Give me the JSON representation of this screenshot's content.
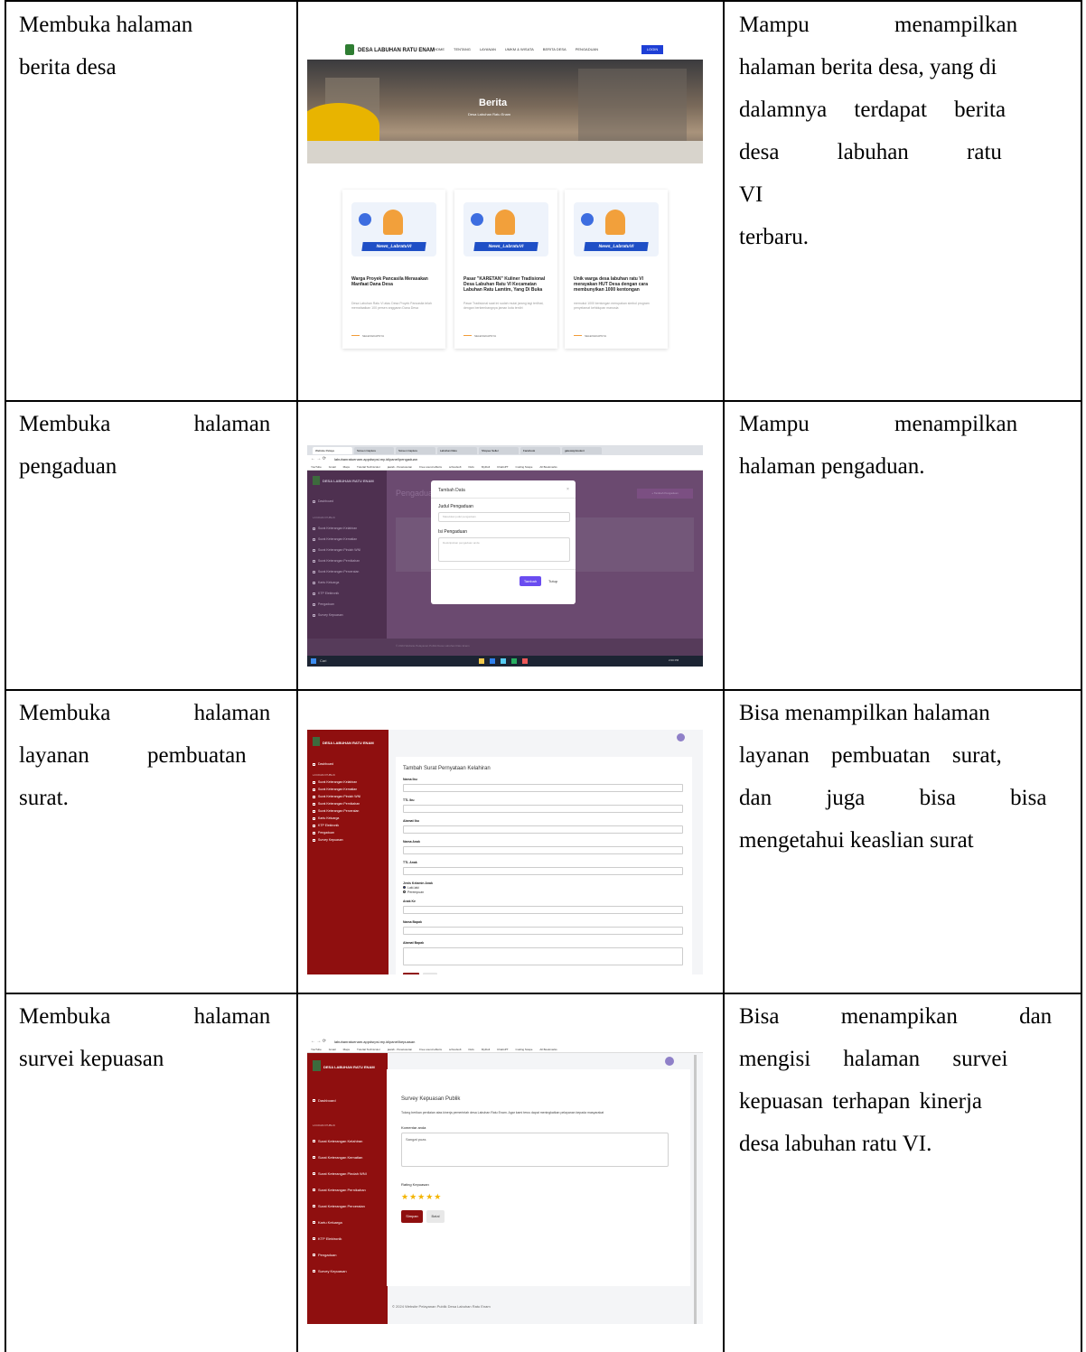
{
  "rows": [
    {
      "scenario": [
        "Membuka halaman",
        "berita desa"
      ],
      "result": [
        "Mampu menampilkan",
        "halaman berita desa, yang di",
        "dalamnya terdapat berita",
        "desa labuhan ratu VI",
        "terbaru."
      ]
    },
    {
      "scenario": [
        "Membuka halaman",
        "pengaduan"
      ],
      "result": [
        "Mampu menampilkan",
        "halaman  pengaduan."
      ]
    },
    {
      "scenario": [
        "Membuka halaman",
        "layanan pembuatan",
        "surat."
      ],
      "result": [
        "Bisa menampilkan halaman",
        "layanan pembuatan surat,",
        "dan juga bisa bisa",
        "mengetahui  keaslian surat"
      ]
    },
    {
      "scenario": [
        "Membuka halaman",
        "survei kepuasan"
      ],
      "result": [
        "Bisa menampikan dan",
        "mengisi halaman survei",
        "kepuasan terhapan kinerja",
        "desa labuhan ratu VI."
      ]
    }
  ],
  "shot1": {
    "site_name": "DESA LABUHAN RATU ENAM",
    "nav": [
      "HOME",
      "TENTANG",
      "LAYANAN",
      "UMKM & WISATA",
      "BERITA DESA",
      "PENGADUAN"
    ],
    "login": "LOGIN",
    "hero_title": "Berita",
    "hero_sub": "Desa Labuhan Ratu Enam",
    "thumb_label": "News_LabratuVI",
    "cards": [
      {
        "title": "Warga Proyek Pancasila Merasakan Manfaat Dana Desa",
        "excerpt": "Desa Labuhan Ratu VI atau Desa Proyek Pancasila telah memafaatkan 100 persen anggaran Dana Desa",
        "author": "SELENGKAPNYA"
      },
      {
        "title": "Pasar \"KARETAN\" Kuliner Tradisional Desa Labuhan Ratu VI Kecamatan Labuhan Ratu Lamtim, Yang Di Buka",
        "excerpt": "Pasar Tradisional saat ini sudah mulai jarang lagi terlihat, dengan berkembangnya jaman kota terdiri",
        "author": "SELENGKAPNYA"
      },
      {
        "title": "Unik warga desa labuhan ratu VI merayakan HUT Desa dengan cara membunyikan 1000 kentongan",
        "excerpt": "memukul 1000 kentongan merupakan simbol program penyelamat kehidupan manusia",
        "author": "SELENGKAPNYA"
      }
    ]
  },
  "shot2": {
    "url": "labuhanratuenam.appdsrpsi.my.id/panel/pengaduan",
    "tabs": [
      "Website Pelaya",
      "Screen Capture",
      "Screen Capture",
      "Labuhan Ratu",
      "Shopee Seller",
      "Facebook",
      "gateway/student"
    ],
    "bookmarks": [
      "YouTube",
      "Gmail",
      "Maps",
      "Tutorial Technicolor",
      "jawab - Penelusuran",
      "Free sound effects",
      "schoolsoft",
      "Dufo",
      "MyDoll",
      "ChatGPT",
      "Coding Scape",
      "All Bookmarks"
    ],
    "site_name": "DESA LABUHAN RATU ENAM",
    "sidebar": [
      "Dashboard",
      "LAYANAN PUBLIK",
      "Surat Keterangan Kelahiran",
      "Surat Keterangan Kematian",
      "Surat Keterangan Pindah WNI",
      "Surat Keterangan Pernikahan",
      "Surat Keterangan Perceraian",
      "Kartu Keluarga",
      "KTP Elektronik",
      "Pengaduan",
      "Survey Kepuasan"
    ],
    "page_title": "Pengaduan",
    "add_btn": "+ Tambah Pengaduan",
    "modal_title": "Tambah Data",
    "label_judul": "Judul Pengaduan",
    "ph_judul": "Masukkan judul pengaduan",
    "label_isi": "Isi Pengaduan",
    "ph_isi": "Deskripsikan pengaduan anda",
    "btn_tambah": "Tambah",
    "btn_tutup": "Tutup",
    "footer": "© 2024 Website Pelayanan Publik Desa Labuhan Ratu Enam",
    "taskbar_search": "Cari",
    "clock": "2:00 PM"
  },
  "shot3": {
    "site_name": "DESA LABUHAN RATU ENAM",
    "sidebar": [
      "Dashboard",
      "LAYANAN PUBLIK",
      "Surat Keterangan Kelahiran",
      "Surat Keterangan Kematian",
      "Surat Keterangan Pindah WNI",
      "Surat Keterangan Pernikahan",
      "Surat Keterangan Perceraian",
      "Kartu Keluarga",
      "KTP Elektronik",
      "Pengaduan",
      "Survey Kepuasan"
    ],
    "form_title": "Tambah Surat Pernyataan Kelahiran",
    "fields": [
      "Nama Ibu",
      "TTL Ibu",
      "Alamat Ibu",
      "Nama Anak",
      "TTL Anak"
    ],
    "gender_label": "Jenis Kelamin Anak",
    "gender_options": [
      "Laki-laki",
      "Perempuan"
    ],
    "fields2": [
      "Anak Ke",
      "Nama Bapak"
    ],
    "address_label": "Alamat Bapak",
    "btn_save": "Simpan",
    "btn_cancel": "Batal"
  },
  "shot4": {
    "url": "labuhanratuenam.appdsrpsi.my.id/panel/kepuasan",
    "bookmarks": [
      "YouTube",
      "Gmail",
      "Maps",
      "Tutorial Technicolor",
      "jawab - Penelusuran",
      "Free sound effects",
      "schoolsoft",
      "Dufo",
      "MyDoll",
      "ChatGPT",
      "Coding Scape",
      "All Bookmarks"
    ],
    "site_name": "DESA LABUHAN RATU ENAM",
    "sidebar": [
      "Dashboard",
      "LAYANAN PUBLIK",
      "Surat Keterangan Kelahiran",
      "Surat Keterangan Kematian",
      "Surat Keterangan Pindah WNI",
      "Surat Keterangan Pernikahan",
      "Surat Keterangan Perceraian",
      "Kartu Keluarga",
      "KTP Elektronik",
      "Pengaduan",
      "Survey Kepuasan"
    ],
    "survey_title": "Survey Kepuasan Publik",
    "survey_desc": "Tolong berikan penilaian atas kinerja pemerintah desa Labuhan Ratu Enam. Agar kami terus dapat meningkatkan pelayanan kepada masyarakat",
    "comment_label": "Komentar anda",
    "comment_value": "Sangat puas",
    "rating_label": "Rating Kepuasan",
    "rating": 5,
    "rating_stars": "★★★★★",
    "btn_save": "Simpan",
    "btn_cancel": "Batal",
    "footer": "© 2024 Website Pelayanan Publik Desa Labuhan Ratu Enam"
  },
  "colors": {
    "sidebar_red": "#8f0f0f",
    "modal_overlay_purple": "#5b3a63",
    "accent_blue": "#1e3fd6",
    "primary_btn": "#6a4cf0",
    "star": "#f3b400"
  }
}
